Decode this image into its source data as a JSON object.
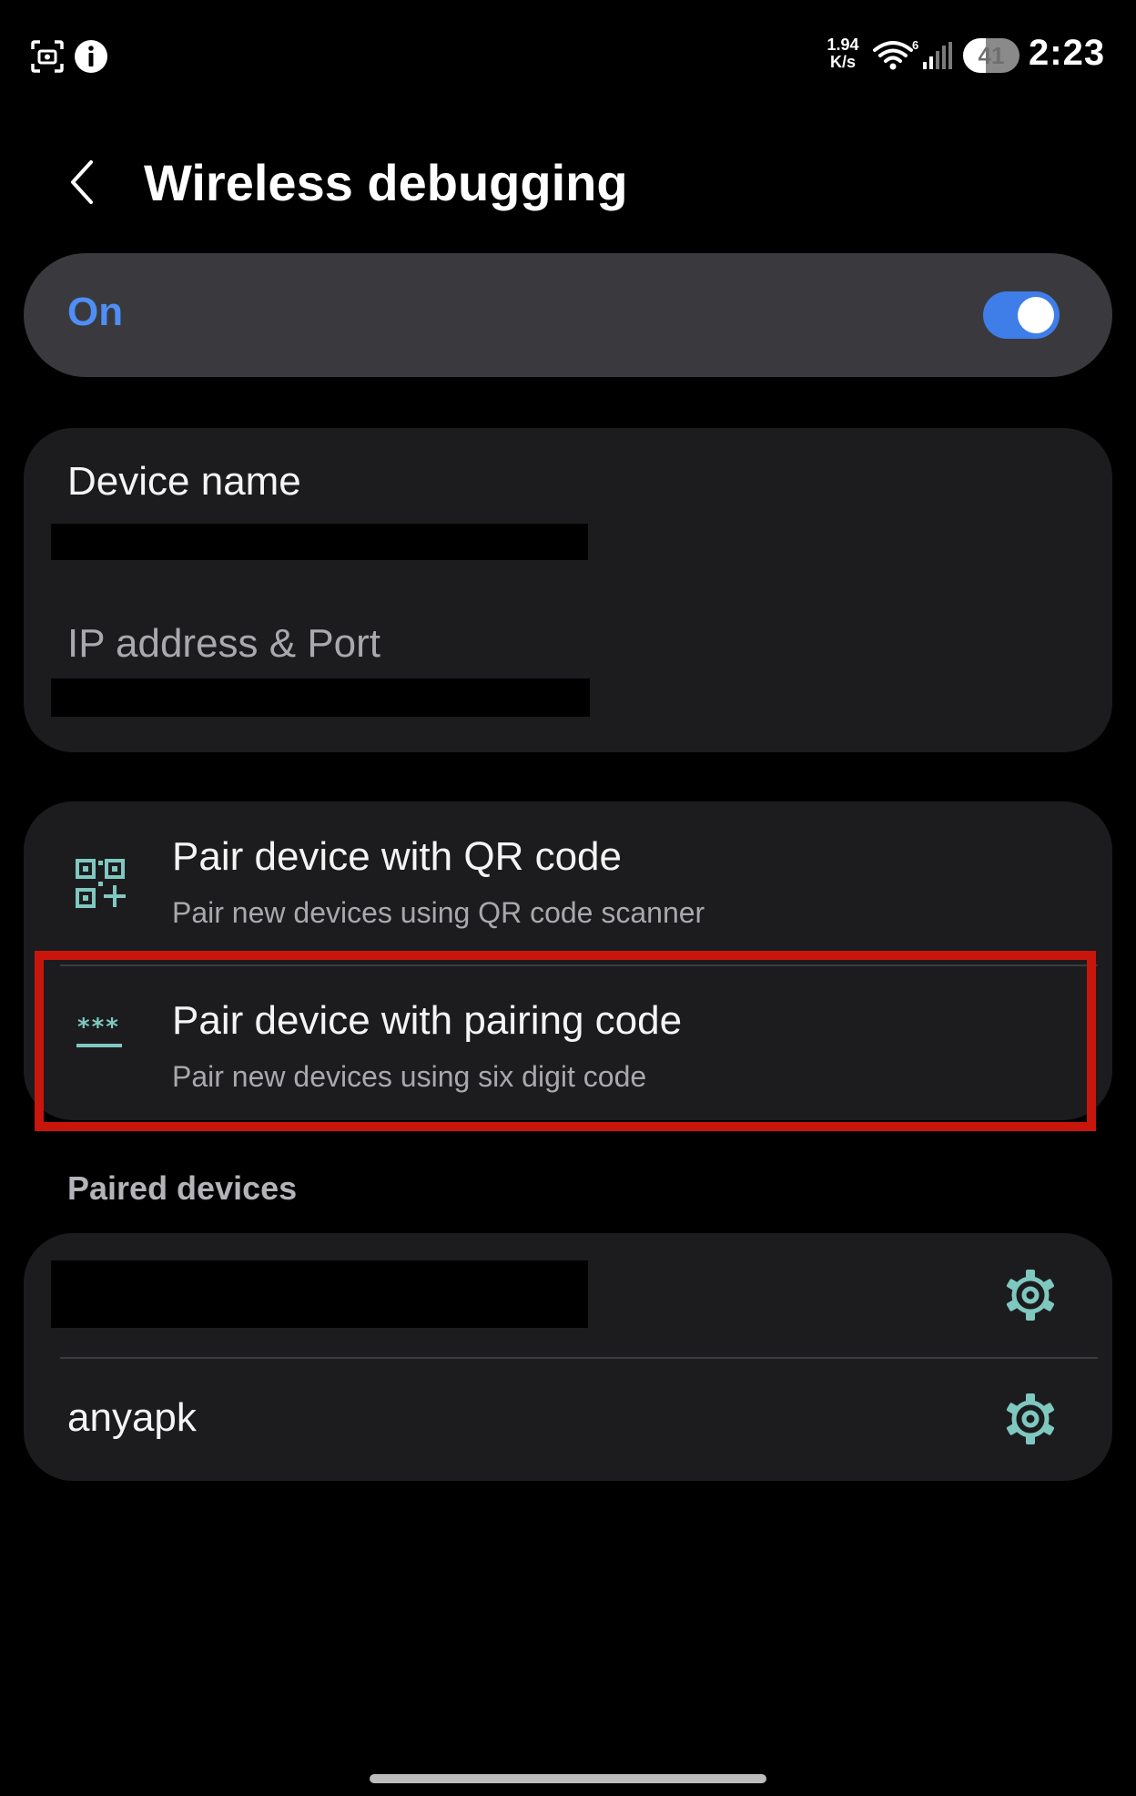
{
  "status_bar": {
    "speed_value": "1.94",
    "speed_unit": "K/s",
    "wifi_badge": "6",
    "battery_level": "41",
    "battery_fraction": 0.41,
    "time": "2:23",
    "left_icons": [
      "screenshot-scan-icon",
      "info-icon"
    ]
  },
  "header": {
    "title": "Wireless debugging",
    "back_icon": "chevron-left-icon"
  },
  "master_switch": {
    "label": "On",
    "checked": true
  },
  "device_info": {
    "device_name_label": "Device name",
    "ip_port_label": "IP address & Port"
  },
  "pairing": {
    "qr": {
      "title": "Pair device with QR code",
      "subtitle": "Pair new devices using QR code scanner",
      "icon": "qr-add-icon"
    },
    "code": {
      "title": "Pair device with pairing code",
      "subtitle": "Pair new devices using six digit code",
      "icon": "pairing-code-icon"
    }
  },
  "paired_devices": {
    "header": "Paired devices",
    "items": [
      {
        "name": "",
        "icon": "gear-icon"
      },
      {
        "name": "anyapk",
        "icon": "gear-icon"
      }
    ]
  },
  "colors": {
    "accent": "#4f8ef7",
    "toggle_on": "#3f7de8",
    "teal_icon": "#7fc8c0",
    "highlight": "#c8160c",
    "card_bg": "#1c1c1e"
  }
}
